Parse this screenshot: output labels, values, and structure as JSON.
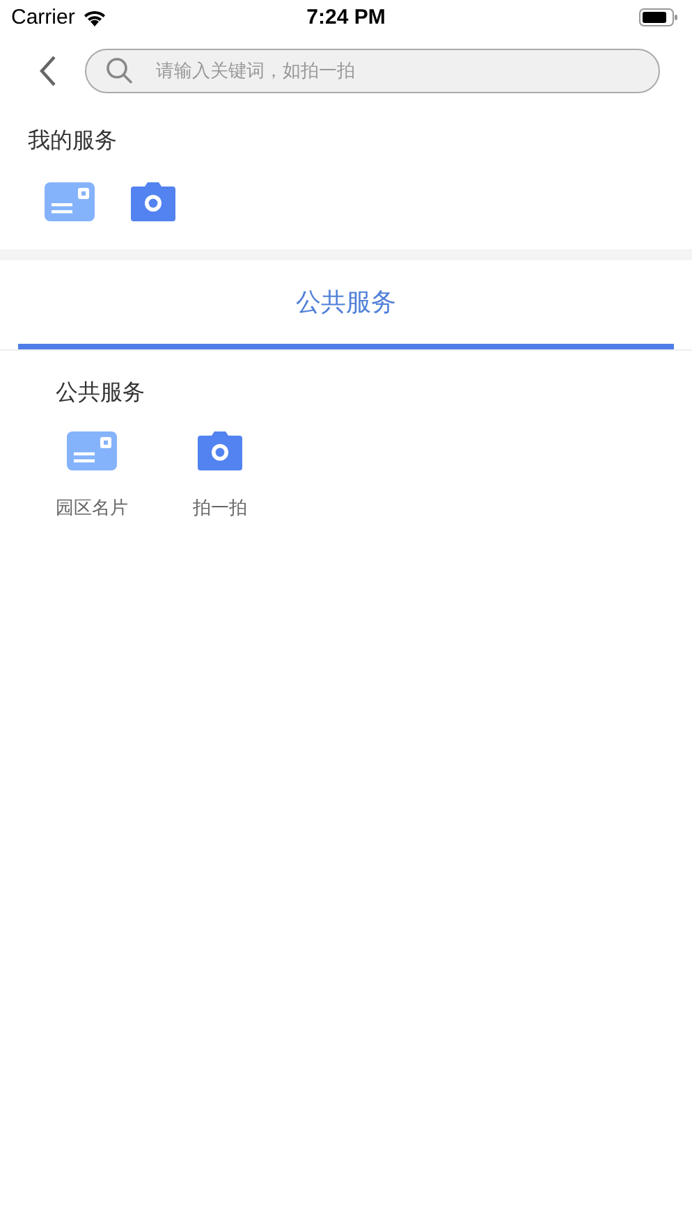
{
  "status_bar": {
    "carrier": "Carrier",
    "time": "7:24 PM"
  },
  "search": {
    "placeholder": "请输入关键词，如拍一拍"
  },
  "my_services": {
    "title": "我的服务",
    "items": [
      {
        "kind": "card"
      },
      {
        "kind": "camera"
      }
    ]
  },
  "tabs": [
    {
      "label": "公共服务",
      "selected": true
    }
  ],
  "public_services": {
    "title": "公共服务",
    "items": [
      {
        "kind": "card",
        "label": "园区名片"
      },
      {
        "kind": "camera",
        "label": "拍一拍"
      }
    ]
  }
}
